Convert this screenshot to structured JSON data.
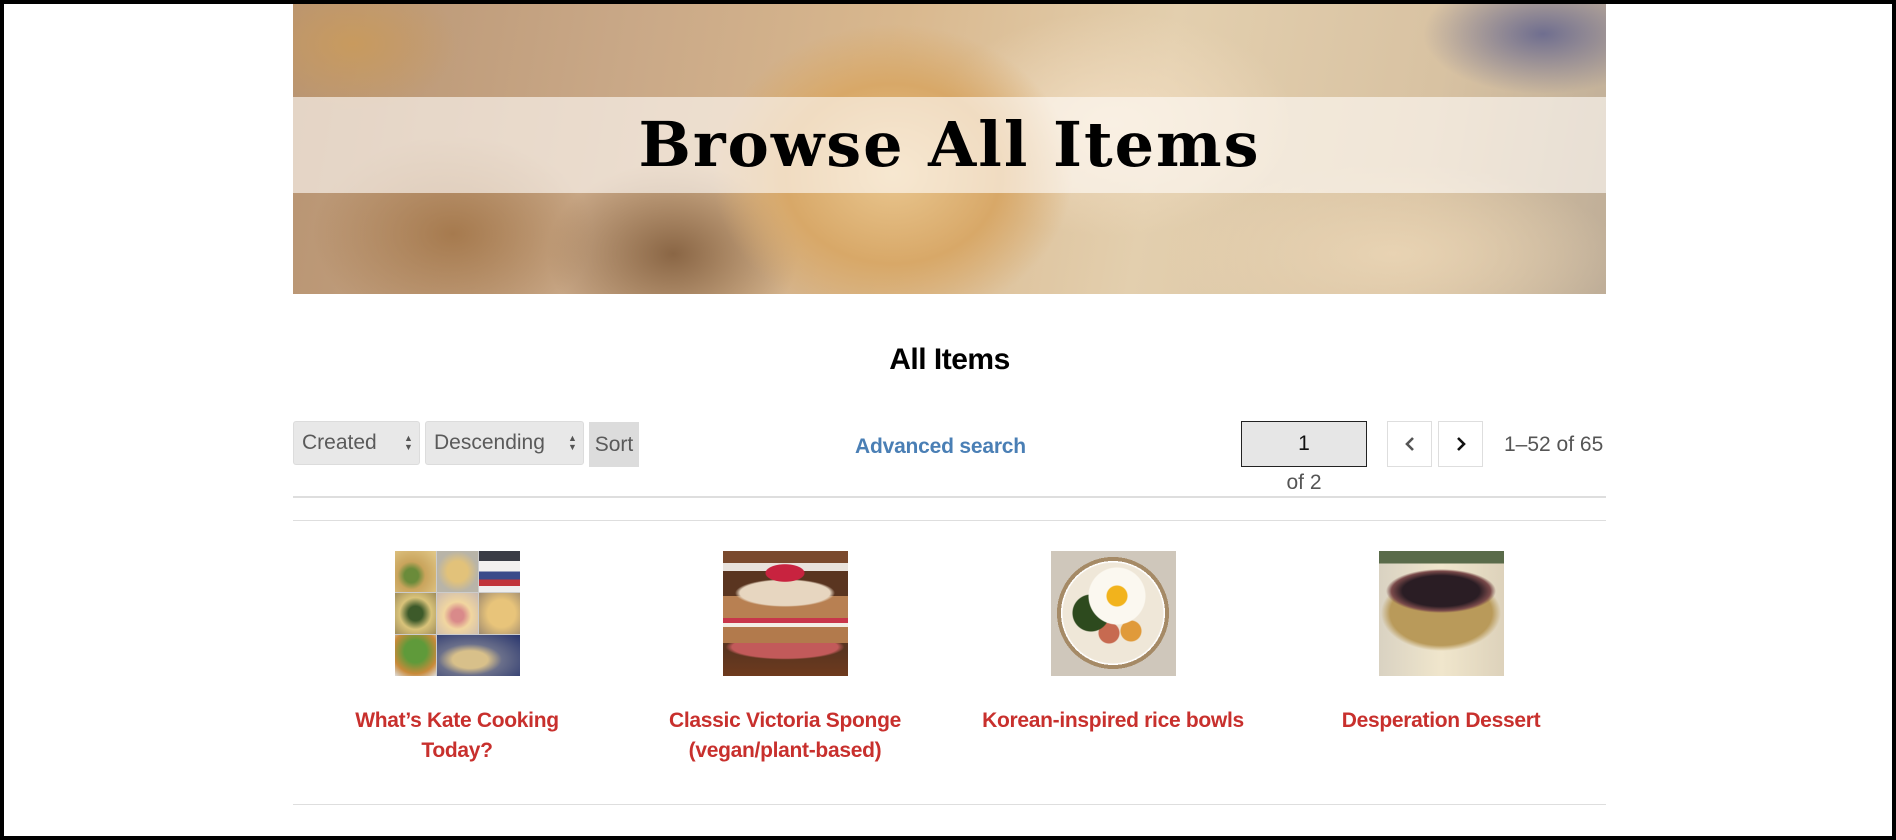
{
  "banner": {
    "title": "Browse All Items"
  },
  "section": {
    "title": "All Items"
  },
  "controls": {
    "sort_field": {
      "selected": "Created"
    },
    "sort_order": {
      "selected": "Descending"
    },
    "sort_button_label": "Sort",
    "advanced_search_label": "Advanced search",
    "pagination": {
      "current_page": "1",
      "total_pages_label": "of 2",
      "prev_icon": "chevron-left-icon",
      "next_icon": "chevron-right-icon",
      "range_label": "1–52 of 65"
    }
  },
  "items": [
    {
      "title": "What’s Kate Cooking Today?",
      "thumbnail": "collage of dishes"
    },
    {
      "title": "Classic Victoria Sponge (vegan/plant-based)",
      "thumbnail": "layer cake with raspberries"
    },
    {
      "title": "Korean-inspired rice bowls",
      "thumbnail": "rice bowl with fried egg"
    },
    {
      "title": "Desperation Dessert",
      "thumbnail": "baked dessert in glass dish"
    }
  ],
  "colors": {
    "link_blue": "#4a7fb5",
    "item_title_red": "#c8302d",
    "control_gray": "#e8e8e8"
  }
}
